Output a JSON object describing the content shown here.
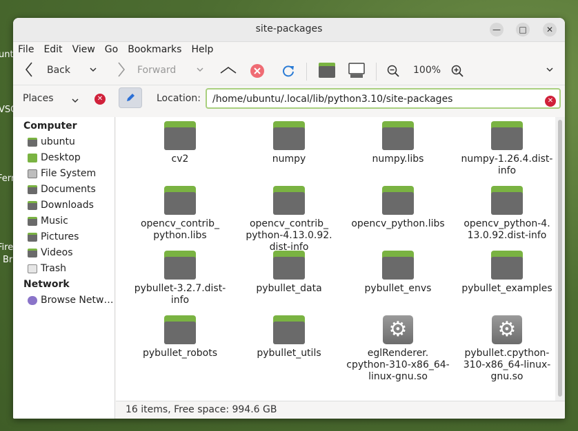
{
  "desktop": {
    "left_labels": [
      "unt",
      "VSC",
      "Ferm",
      "Fire",
      "Br"
    ]
  },
  "window": {
    "title": "site-packages",
    "minimize_glyph": "—",
    "maximize_glyph": "□",
    "close_glyph": "✕"
  },
  "menu": [
    "File",
    "Edit",
    "View",
    "Go",
    "Bookmarks",
    "Help"
  ],
  "toolbar": {
    "back": "Back",
    "forward": "Forward",
    "zoom": "100%"
  },
  "location": {
    "places_label": "Places",
    "label": "Location:",
    "value": "/home/ubuntu/.local/lib/python3.10/site-packages"
  },
  "sidebar": {
    "computer_heading": "Computer",
    "computer_items": [
      {
        "label": "ubuntu",
        "icon": "home-folder-icon"
      },
      {
        "label": "Desktop",
        "icon": "desktop-icon"
      },
      {
        "label": "File System",
        "icon": "drive-icon"
      },
      {
        "label": "Documents",
        "icon": "folder-icon"
      },
      {
        "label": "Downloads",
        "icon": "folder-icon"
      },
      {
        "label": "Music",
        "icon": "folder-icon"
      },
      {
        "label": "Pictures",
        "icon": "folder-icon"
      },
      {
        "label": "Videos",
        "icon": "folder-icon"
      },
      {
        "label": "Trash",
        "icon": "trash-icon"
      }
    ],
    "network_heading": "Network",
    "network_items": [
      {
        "label": "Browse Netw…",
        "icon": "network-icon"
      }
    ]
  },
  "files": [
    {
      "name": "cv2",
      "type": "folder"
    },
    {
      "name": "numpy",
      "type": "folder"
    },
    {
      "name": "numpy.libs",
      "type": "folder"
    },
    {
      "name": "numpy-1.26.4.dist-\ninfo",
      "type": "folder"
    },
    {
      "name": "opencv_contrib_\npython.libs",
      "type": "folder"
    },
    {
      "name": "opencv_contrib_\npython-4.13.0.92.\ndist-info",
      "type": "folder"
    },
    {
      "name": "opencv_python.libs",
      "type": "folder"
    },
    {
      "name": "opencv_python-4.\n13.0.92.dist-info",
      "type": "folder"
    },
    {
      "name": "pybullet-3.2.7.dist-\ninfo",
      "type": "folder"
    },
    {
      "name": "pybullet_data",
      "type": "folder"
    },
    {
      "name": "pybullet_envs",
      "type": "folder"
    },
    {
      "name": "pybullet_examples",
      "type": "folder"
    },
    {
      "name": "pybullet_robots",
      "type": "folder"
    },
    {
      "name": "pybullet_utils",
      "type": "folder"
    },
    {
      "name": "eglRenderer.\ncpython-310-x86_64-\nlinux-gnu.so",
      "type": "library"
    },
    {
      "name": "pybullet.cpython-\n310-x86_64-linux-\ngnu.so",
      "type": "library"
    }
  ],
  "status": "16 items, Free space: 994.6 GB",
  "colors": {
    "folder_green": "#7ab342",
    "folder_gray": "#6a6a6a",
    "accent_red": "#d0213a",
    "focus_green": "#a9cf7e"
  }
}
